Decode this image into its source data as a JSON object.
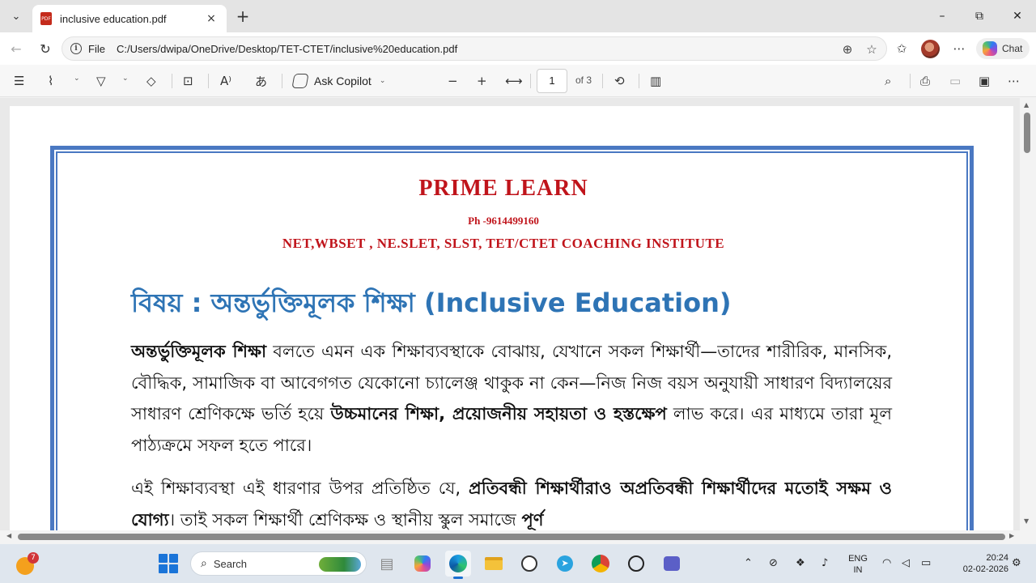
{
  "browser": {
    "tab": {
      "title": "inclusive education.pdf",
      "icon": "pdf-file-icon",
      "close": "×"
    },
    "new_tab": "+",
    "window": {
      "minimize": "–",
      "maximize": "⧉",
      "close": "✕"
    },
    "address": {
      "scheme": "File",
      "url": "C:/Users/dwipa/OneDrive/Desktop/TET-CTET/inclusive%20education.pdf"
    },
    "chat_label": "Chat"
  },
  "pdf_toolbar": {
    "ask_copilot": "Ask Copilot",
    "page_current": "1",
    "page_of": "of 3"
  },
  "document": {
    "title": "PRIME LEARN",
    "phone": "Ph -9614499160",
    "subtitle": "NET,WBSET , NE.SLET, SLST, TET/CTET COACHING INSTITUTE",
    "heading": "বিষয় : অন্তর্ভুক্তিমূলক শিক্ষা (Inclusive Education)",
    "para1": {
      "b1": "অন্তর্ভুক্তিমূলক শিক্ষা",
      "t1": " বলতে এমন এক শিক্ষাব্যবস্থাকে বোঝায়, যেখানে সকল শিক্ষার্থী—তাদের শারীরিক, মানসিক, বৌদ্ধিক, সামাজিক বা আবেগগত যেকোনো চ্যালেঞ্জ থাকুক না কেন—নিজ নিজ বয়স অনুযায়ী সাধারণ বিদ্যালয়ের সাধারণ শ্রেণিকক্ষে ভর্তি হয়ে ",
      "b2": "উচ্চমানের শিক্ষা, প্রয়োজনীয় সহায়তা ও হস্তক্ষেপ",
      "t2": " লাভ করে। এর মাধ্যমে তারা মূল পাঠ্যক্রমে সফল হতে পারে।"
    },
    "para2": {
      "t1": "এই শিক্ষাব্যবস্থা এই ধারণার উপর প্রতিষ্ঠিত যে, ",
      "b1": "প্রতিবন্ধী শিক্ষার্থীরাও অপ্রতিবন্ধী শিক্ষার্থীদের মতোই সক্ষম ও যোগ্য",
      "t2": "। তাই সকল শিক্ষার্থী শ্রেণিকক্ষ ও স্থানীয় স্কুল সমাজে ",
      "b2": "পূর্ণ"
    }
  },
  "taskbar": {
    "weather_badge": "7",
    "search_label": "Search",
    "lang_line1": "ENG",
    "lang_line2": "IN",
    "time": "20:24",
    "date": "02-02-2026"
  },
  "colors": {
    "doc_title_red": "#c0141b",
    "heading_blue": "#2e74b5",
    "page_border_blue": "#4a78c2",
    "windows_blue": "#1a74d8"
  }
}
